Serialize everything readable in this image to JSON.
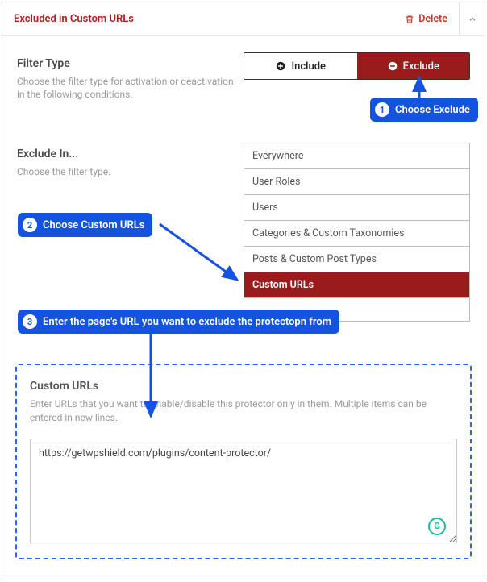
{
  "panel": {
    "title": "Excluded in Custom URLs",
    "delete": "Delete"
  },
  "filter": {
    "title": "Filter Type",
    "desc": "Choose the filter type for activation or deactivation in the following conditions.",
    "include": "Include",
    "exclude": "Exclude"
  },
  "excludeIn": {
    "title": "Exclude In...",
    "desc": "Choose the filter type.",
    "items": [
      "Everywhere",
      "User Roles",
      "Users",
      "Categories & Custom Taxonomies",
      "Posts & Custom Post Types",
      "Custom URLs"
    ]
  },
  "custom": {
    "title": "Custom URLs",
    "desc": "Enter URLs that you want to enable/disable this protector only in them. Multiple items can be entered in new lines.",
    "value": "https://getwpshield.com/plugins/content-protector/"
  },
  "callouts": {
    "c1": "Choose Exclude",
    "c2": "Choose Custom URLs",
    "c3": "Enter the page's URL you want to exclude the protectopn from"
  },
  "icons": {
    "grammarly": "G"
  }
}
